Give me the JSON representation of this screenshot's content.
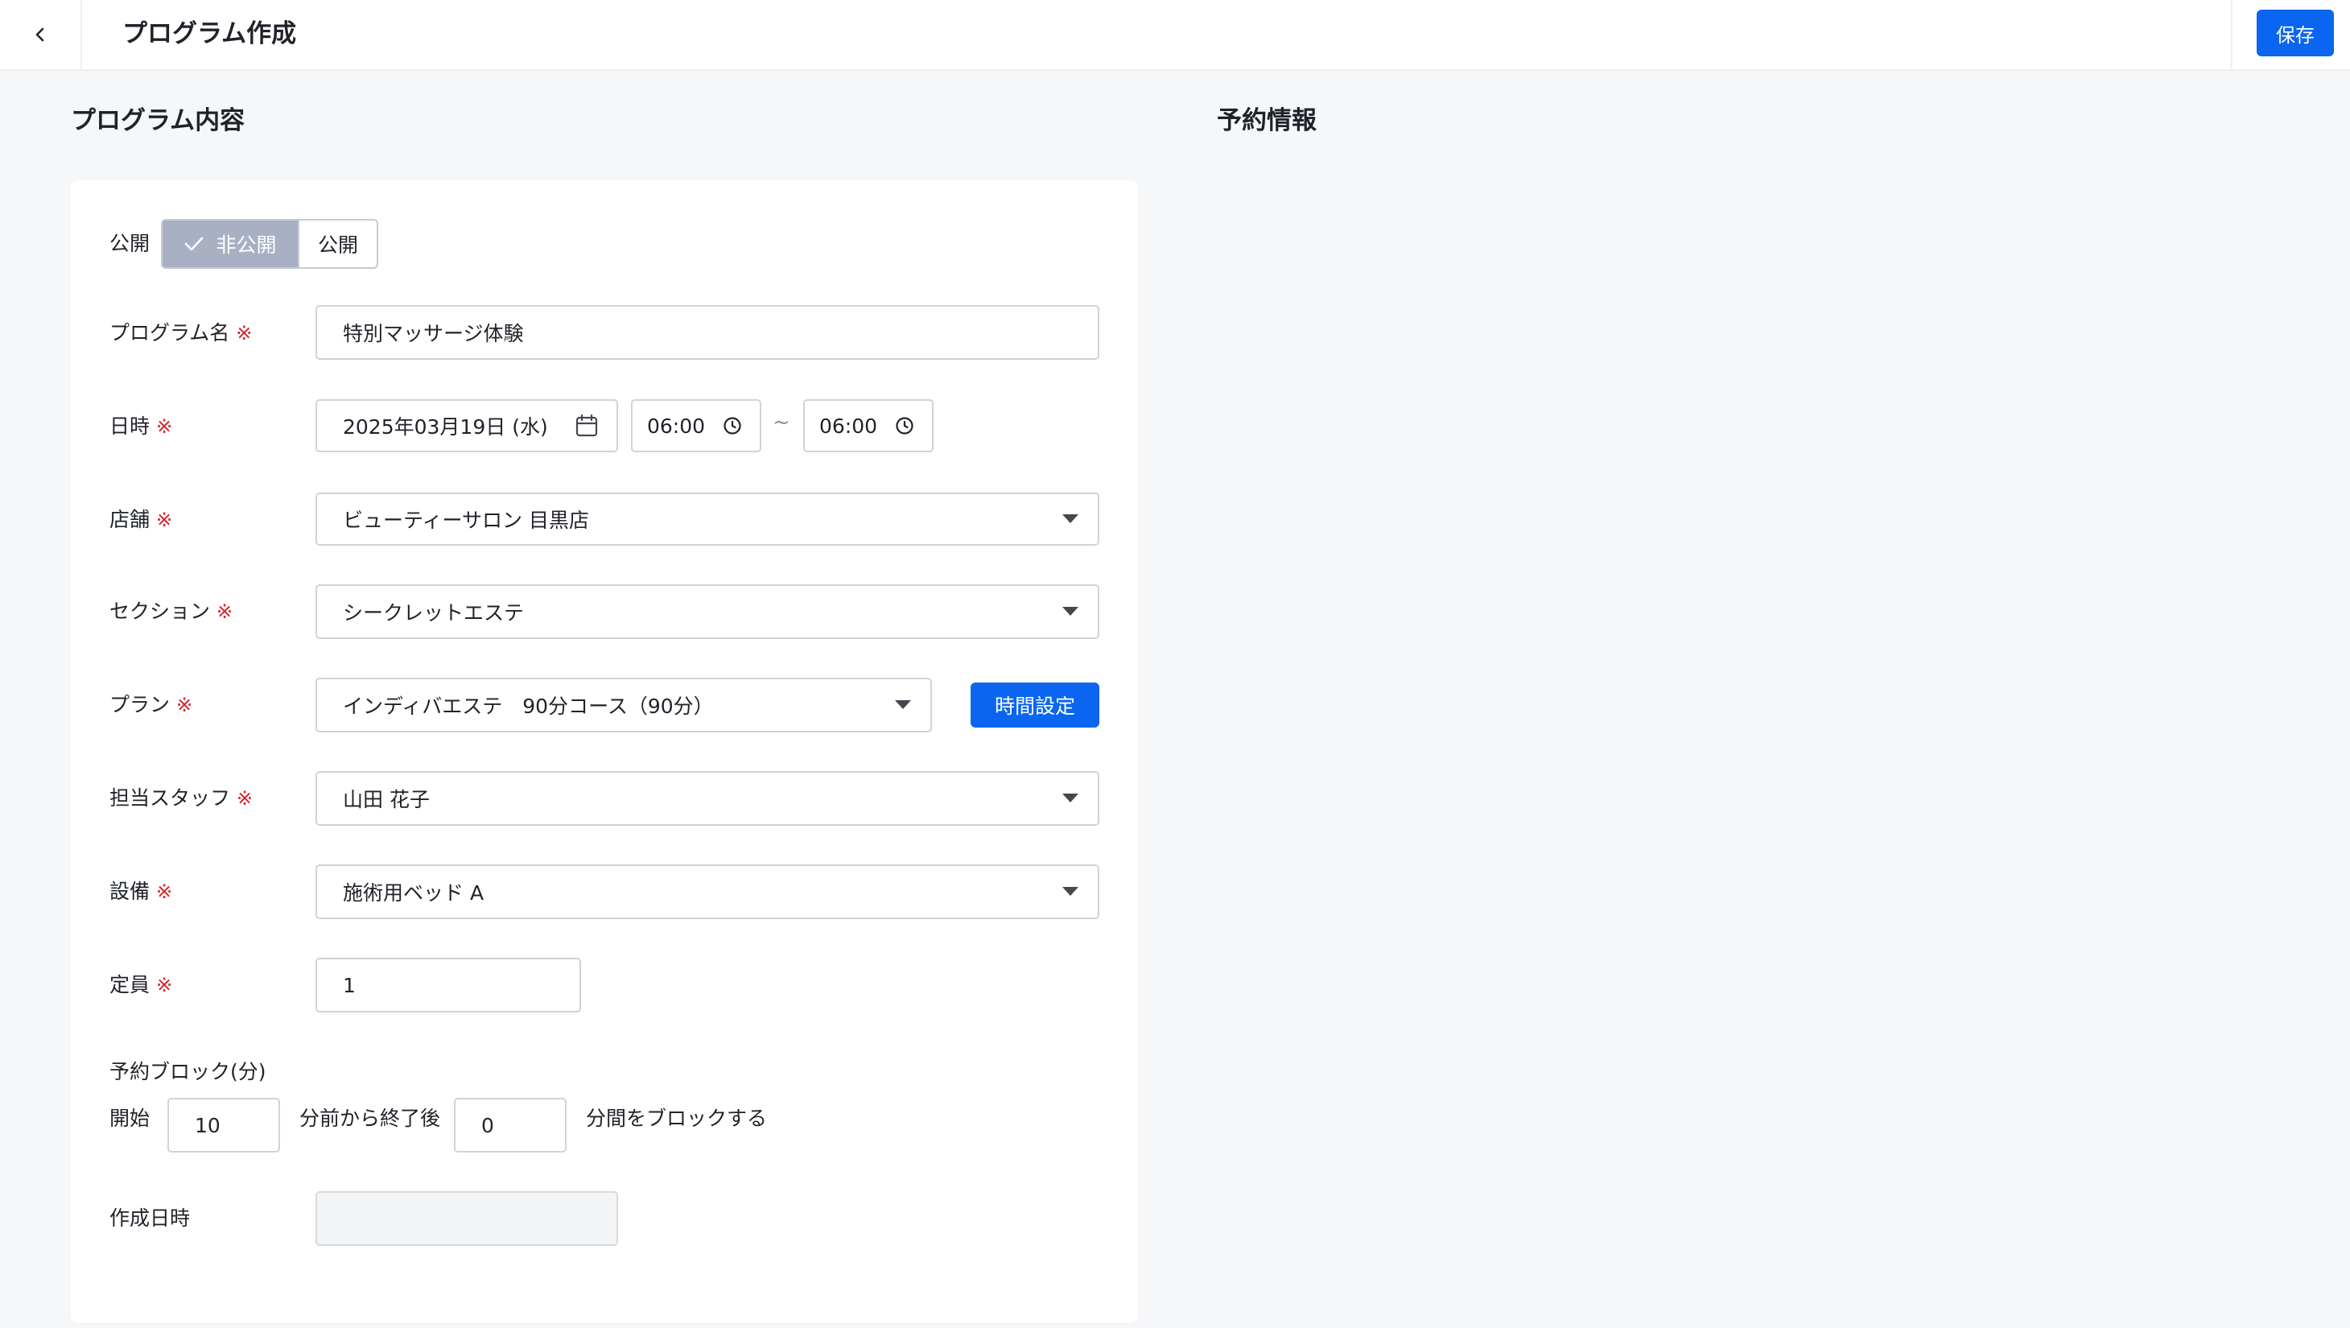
{
  "header": {
    "title": "プログラム作成",
    "save_label": "保存"
  },
  "left": {
    "title": "プログラム内容"
  },
  "right": {
    "title": "予約情報"
  },
  "form": {
    "visibility": {
      "label": "公開",
      "private_label": "非公開",
      "public_label": "公開",
      "selected": "非公開"
    },
    "required_mark": "※",
    "program_name": {
      "label": "プログラム名",
      "value": "特別マッサージ体験"
    },
    "datetime": {
      "label": "日時",
      "date": "2025年03月19日 (水)",
      "start": "06:00",
      "separator": "~",
      "end": "06:00"
    },
    "store": {
      "label": "店舗",
      "value": "ビューティーサロン 目黒店"
    },
    "section": {
      "label": "セクション",
      "value": "シークレットエステ"
    },
    "plan": {
      "label": "プラン",
      "value": "インディバエステ　90分コース（90分）",
      "time_button": "時間設定"
    },
    "staff": {
      "label": "担当スタッフ",
      "value": "山田 花子"
    },
    "equipment": {
      "label": "設備",
      "value": "施術用ベッド A"
    },
    "capacity": {
      "label": "定員",
      "value": "1"
    },
    "block": {
      "label": "予約ブロック(分)",
      "start_label": "開始",
      "before_value": "10",
      "middle_label": "分前から終了後",
      "after_value": "0",
      "end_label": "分間をブロックする"
    },
    "created": {
      "label": "作成日時",
      "value": ""
    }
  },
  "colors": {
    "accent": "#0a66f0",
    "required": "#d4232d",
    "toggle_selected": "#a9b0c3",
    "background": "#f6f7f9"
  }
}
